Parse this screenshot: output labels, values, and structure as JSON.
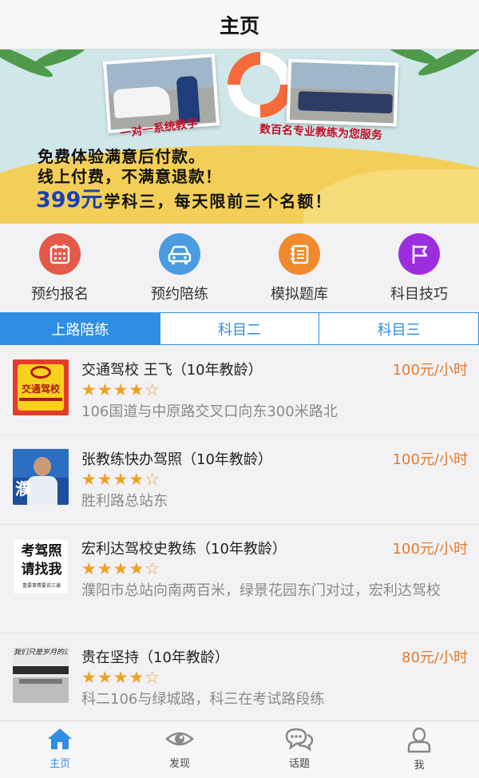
{
  "navbar": {
    "title": "主页"
  },
  "banner": {
    "caption_left": "一对一系统教学",
    "caption_right": "数百名专业教练为您服务",
    "line1": "免费体验满意后付款。",
    "line2": "线上付费，不满意退款！",
    "line3_price": "399元",
    "line3_rest": "学科三，每天限前三个名额！"
  },
  "quick_actions": [
    {
      "label": "预约报名",
      "icon": "calendar-icon",
      "color": "#e4594a"
    },
    {
      "label": "预约陪练",
      "icon": "car-icon",
      "color": "#4a9be0"
    },
    {
      "label": "模拟题库",
      "icon": "notebook-icon",
      "color": "#f08a2e"
    },
    {
      "label": "科目技巧",
      "icon": "flag-icon",
      "color": "#9b2fe0"
    }
  ],
  "tabs": [
    {
      "label": "上路陪练",
      "active": true
    },
    {
      "label": "科目二",
      "active": false
    },
    {
      "label": "科目三",
      "active": false
    }
  ],
  "coaches": [
    {
      "name": "交通驾校 王飞（10年教龄）",
      "price": "100元/小时",
      "rating": "★★★★☆",
      "address": "106国道与中原路交叉口向东300米路北",
      "thumb_text": "交通驾校"
    },
    {
      "name": "张教练快办驾照（10年教龄）",
      "price": "100元/小时",
      "rating": "★★★★☆",
      "address": "胜利路总站东",
      "thumb_text": "濮"
    },
    {
      "name": "宏利达驾校史教练（10年教龄）",
      "price": "100元/小时",
      "rating": "★★★★☆",
      "address": "濮阳市总站向南两百米，绿景花园东门对过，宏利达驾校",
      "thumb_text": "考驾照请找我",
      "thumb_sub": "重要事情要说三遍"
    },
    {
      "name": "贵在坚持（10年教龄）",
      "price": "80元/小时",
      "rating": "★★★★☆",
      "address": "科二106与绿城路，科三在考试路段练",
      "thumb_text": "我们只是岁月的过客"
    }
  ],
  "tabbar": [
    {
      "label": "主页",
      "icon": "home-icon",
      "active": true
    },
    {
      "label": "发现",
      "icon": "eye-icon",
      "active": false
    },
    {
      "label": "话题",
      "icon": "chat-icon",
      "active": false
    },
    {
      "label": "我",
      "icon": "user-icon",
      "active": false
    }
  ],
  "colors": {
    "accent": "#2f8de4",
    "price": "#e47a2b",
    "star": "#f0a020"
  }
}
